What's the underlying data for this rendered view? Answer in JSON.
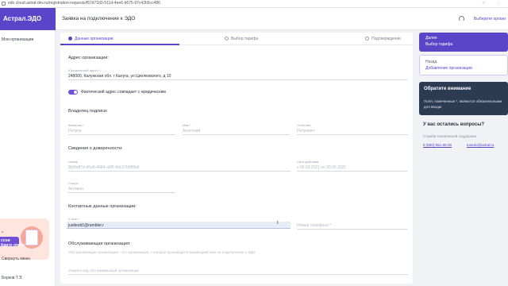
{
  "browser": {
    "url": "edo.cloud.astral-dev.ru/registration-requests/f67d72d3-511d-4ee6-b675-97c42b5cc486"
  },
  "sidebar": {
    "brand": "Астрал.ЭДО",
    "orgs_label": "Мои организации",
    "promo": {
      "line1": "о",
      "line2": "ссни",
      "line3": "йдите опрос"
    },
    "collapse_label": "Свернуть меню",
    "user_label": "Борков Т.Э."
  },
  "header": {
    "title": "Заявка на подключение к ЭДО",
    "pick_org": "Выберите органи"
  },
  "steps": [
    {
      "label": "Данные организации"
    },
    {
      "label": "Выбор тарифа"
    },
    {
      "label": "Подтверждение"
    }
  ],
  "form": {
    "address_section": "Адрес организации:",
    "legal_address_label": "Юридический адрес *",
    "legal_address_value": "248000, Калужская обл. г Калуга, ул Циолковского, д 10",
    "toggle_label": "Фактический адрес совпадает с юридическим",
    "signer_section": "Владелец подписи:",
    "lastname_label": "Фамилия *",
    "lastname_value": "Петров",
    "firstname_label": "Имя *",
    "firstname_value": "Анатолий",
    "patronymic_label": "Отчество",
    "patronymic_value": "Петрович",
    "poa_section": "Сведения о доверенности:",
    "poa_number_label": "Номер",
    "poa_number_value": "8b2bdf7d-45e8-4684-a6f5-6dc27b8f86dl",
    "poa_dates_label": "Срок действия",
    "poa_dates_value": "с 06.03.2021 по 30.05.2021",
    "poa_status_label": "Статус",
    "poa_status_value": "Активна",
    "contacts_section": "Контактные данные организации:",
    "email_label": "E-mail *",
    "email_value": "justtestt1@rambler.r",
    "phone_placeholder": "Номер телефона *",
    "servicing_section": "Обслуживающая организация:",
    "servicing_desc": "Обслуживающая организация - это организация, с которой производите взаимодействие за подключение к ЭДО",
    "servicing_placeholder": "Укажите код обслуживающей организации"
  },
  "right_panel": {
    "next_line1": "Далее",
    "next_line2": "Выбор тарифа",
    "back_line1": "Назад",
    "back_line2": "Добавление организации",
    "note_title": "Обратите внимание",
    "note_line1": "Поля, помеченные *, являются обязательными",
    "note_line2": "для ввода!",
    "questions_title": "У вас остались вопросы?",
    "support_label": "Служба технической поддержки",
    "phone": "8 (800) 551-80-36",
    "email": "tosedo@astral.ru"
  }
}
